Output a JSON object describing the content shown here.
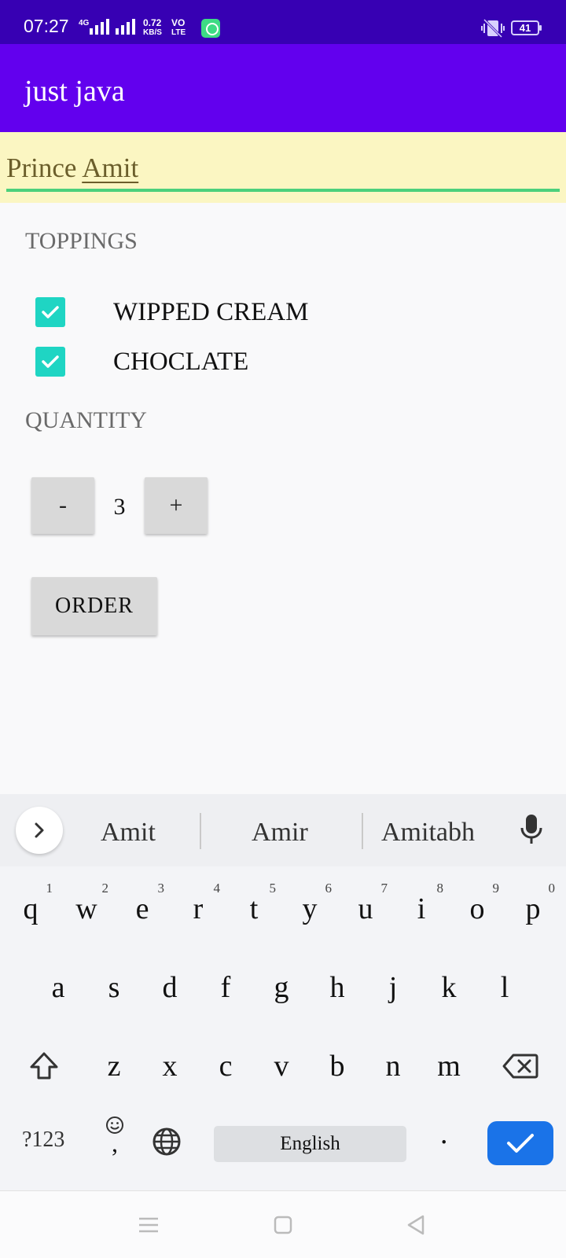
{
  "status_bar": {
    "time": "07:27",
    "net1_small": "4G",
    "speed_value": "0.72",
    "speed_unit": "KB/S",
    "volte_top": "VO",
    "volte_bottom": "LTE",
    "battery": "41"
  },
  "app_bar": {
    "title": "just java"
  },
  "name_input": {
    "value_first": "Prince ",
    "value_second": "Amit"
  },
  "toppings": {
    "label": "TOPPINGS",
    "items": [
      {
        "label": "WIPPED CREAM",
        "checked": true
      },
      {
        "label": "CHOCLATE",
        "checked": true
      }
    ]
  },
  "quantity": {
    "label": "QUANTITY",
    "decrement": "-",
    "value": "3",
    "increment": "+"
  },
  "order_button": {
    "label": "ORDER"
  },
  "keyboard": {
    "suggestions": [
      "Amit",
      "Amir",
      "Amitabh"
    ],
    "row1": [
      {
        "key": "q",
        "hint": "1"
      },
      {
        "key": "w",
        "hint": "2"
      },
      {
        "key": "e",
        "hint": "3"
      },
      {
        "key": "r",
        "hint": "4"
      },
      {
        "key": "t",
        "hint": "5"
      },
      {
        "key": "y",
        "hint": "6"
      },
      {
        "key": "u",
        "hint": "7"
      },
      {
        "key": "i",
        "hint": "8"
      },
      {
        "key": "o",
        "hint": "9"
      },
      {
        "key": "p",
        "hint": "0"
      }
    ],
    "row2": [
      "a",
      "s",
      "d",
      "f",
      "g",
      "h",
      "j",
      "k",
      "l"
    ],
    "row3": [
      "z",
      "x",
      "c",
      "v",
      "b",
      "n",
      "m"
    ],
    "symbols_key": "?123",
    "emoji_comma": ",",
    "space_label": "English",
    "period": "."
  },
  "colors": {
    "status_bar": "#3700b3",
    "app_bar": "#6200ee",
    "checkbox": "#1fd5c3",
    "field_underline": "#4cd07b",
    "enter_key": "#1a73e8"
  }
}
